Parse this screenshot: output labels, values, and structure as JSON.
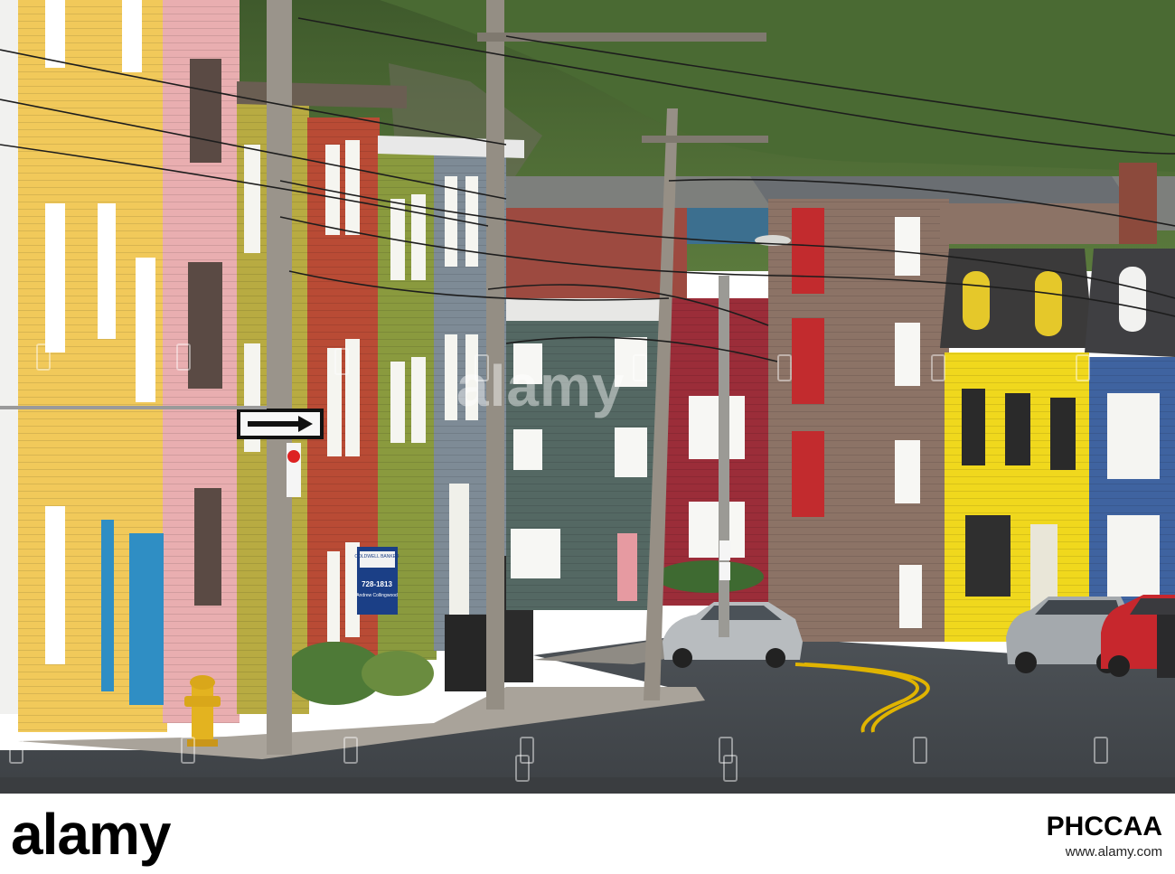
{
  "scene": {
    "real_estate_sign": {
      "brand": "COLDWELL BANKER",
      "phone": "728-1813",
      "agent": "Andrew Collingwood"
    }
  },
  "watermark": {
    "text": "alamy"
  },
  "footer": {
    "logo": "alamy",
    "image_id": "PHCCAA",
    "site": "www.alamy.com"
  }
}
